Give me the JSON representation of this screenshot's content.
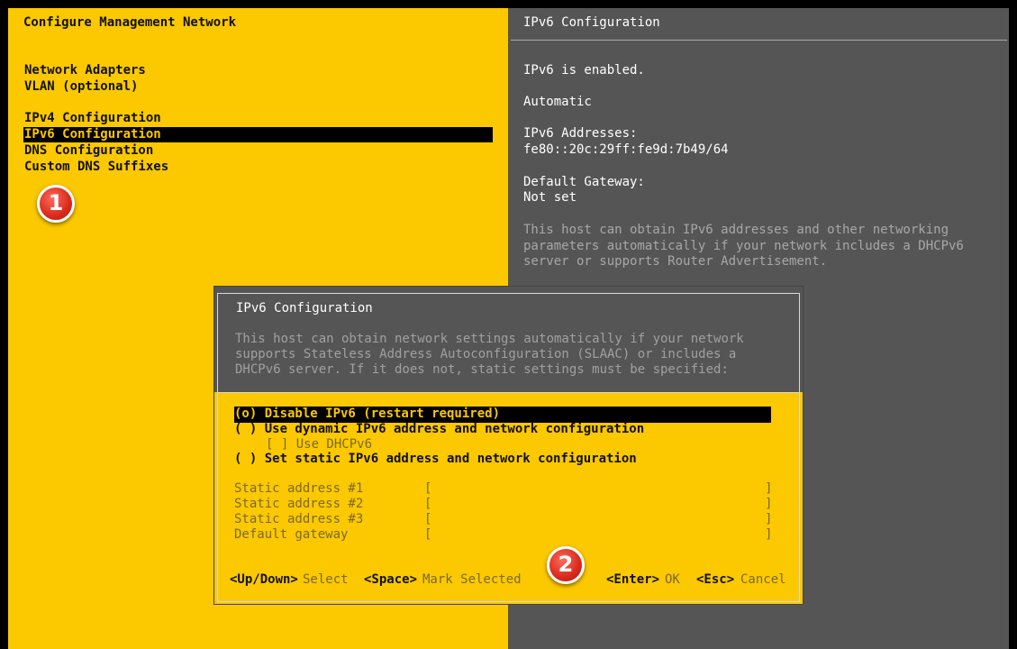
{
  "left_pane": {
    "title": "Configure Management Network",
    "menu": [
      "Network Adapters",
      "VLAN (optional)",
      "IPv4 Configuration",
      "IPv6 Configuration",
      "DNS Configuration",
      "Custom DNS Suffixes"
    ],
    "selected_index": 3
  },
  "right_pane": {
    "title": "IPv6 Configuration",
    "status": "IPv6 is enabled.",
    "mode": "Automatic",
    "addresses_label": "IPv6 Addresses:",
    "addresses_value": "fe80::20c:29ff:fe9d:7b49/64",
    "gateway_label": "Default Gateway:",
    "gateway_value": "Not set",
    "description": [
      "This host can obtain IPv6 addresses and other networking",
      "parameters automatically if your network includes a DHCPv6",
      "server or supports Router Advertisement."
    ]
  },
  "dialog": {
    "title": "IPv6 Configuration",
    "description": [
      "This host can obtain network settings automatically if your network",
      "supports Stateless Address Autoconfiguration (SLAAC) or includes a",
      "DHCPv6 server. If it does not, static settings must be specified:"
    ],
    "options": {
      "disable": "(o) Disable IPv6 (restart required)",
      "dynamic": "( ) Use dynamic IPv6 address and network configuration",
      "dhcp": "[ ] Use DHCPv6",
      "static": "( ) Set static IPv6 address and network configuration"
    },
    "fields": [
      {
        "label": "Static address #1",
        "value": ""
      },
      {
        "label": "Static address #2",
        "value": ""
      },
      {
        "label": "Static address #3",
        "value": ""
      },
      {
        "label": "Default gateway",
        "value": ""
      }
    ],
    "footer": {
      "updown_key": "<Up/Down>",
      "updown_desc": "Select",
      "space_key": "<Space>",
      "space_desc": "Mark Selected",
      "enter_key": "<Enter>",
      "enter_desc": "OK",
      "esc_key": "<Esc>",
      "esc_desc": "Cancel"
    }
  },
  "badges": {
    "one": "1",
    "two": "2"
  },
  "colors": {
    "accent": "#fcc800",
    "panel": "#555555",
    "badge": "#d82a1c"
  }
}
